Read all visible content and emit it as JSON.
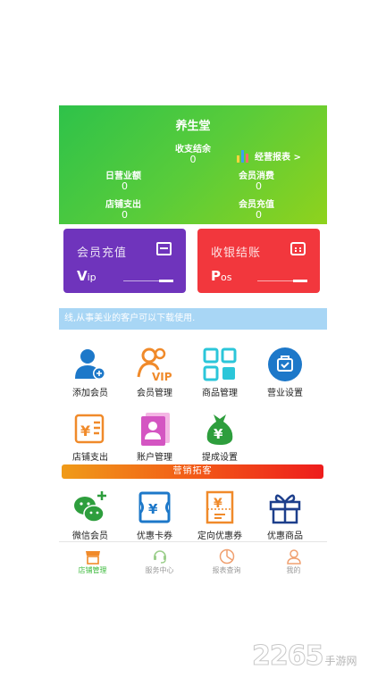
{
  "header": {
    "title": "养生堂",
    "balance_label": "收支结余",
    "balance_value": "0",
    "report_link": "经营报表 >",
    "daily_revenue_label": "日营业额",
    "daily_revenue_value": "0",
    "member_consume_label": "会员消费",
    "member_consume_value": "0",
    "store_expense_label": "店铺支出",
    "store_expense_value": "0",
    "member_recharge_label": "会员充值",
    "member_recharge_value": "0"
  },
  "cards": {
    "vip": {
      "title": "会员充值",
      "tag_big": "V",
      "tag_small": "ip",
      "color": "#6f34bc"
    },
    "pos": {
      "title": "收银结账",
      "tag_big": "P",
      "tag_small": "os",
      "color": "#f2373d"
    }
  },
  "notice": "线,从事美业的客户可以下载使用.",
  "grid": {
    "items": [
      {
        "label": "添加会员",
        "icon": "add-member-icon"
      },
      {
        "label": "会员管理",
        "icon": "vip-member-icon"
      },
      {
        "label": "商品管理",
        "icon": "product-grid-icon"
      },
      {
        "label": "营业设置",
        "icon": "business-settings-icon"
      },
      {
        "label": "店铺支出",
        "icon": "expense-receipt-icon"
      },
      {
        "label": "账户管理",
        "icon": "account-icon"
      },
      {
        "label": "提成设置",
        "icon": "money-bag-icon"
      }
    ]
  },
  "marketing": {
    "banner": "营销拓客",
    "items": [
      {
        "label": "微信会员",
        "icon": "wechat-icon"
      },
      {
        "label": "优惠卡券",
        "icon": "coupon-card-icon"
      },
      {
        "label": "定向优惠券",
        "icon": "targeted-coupon-icon"
      },
      {
        "label": "优惠商品",
        "icon": "gift-icon"
      }
    ]
  },
  "tabbar": {
    "tabs": [
      {
        "label": "店铺管理",
        "icon": "store-icon",
        "active": true
      },
      {
        "label": "服务中心",
        "icon": "service-icon",
        "active": false
      },
      {
        "label": "报表查询",
        "icon": "report-icon",
        "active": false
      },
      {
        "label": "我的",
        "icon": "profile-icon",
        "active": false
      }
    ]
  },
  "watermark": {
    "number": "2265",
    "site": "手游网"
  },
  "colors": {
    "green": "#3cba3c",
    "purple": "#6f34bc",
    "red": "#f2373d",
    "blue": "#1d78c9",
    "orange": "#f08a2a",
    "teal": "#2bc6d9"
  }
}
